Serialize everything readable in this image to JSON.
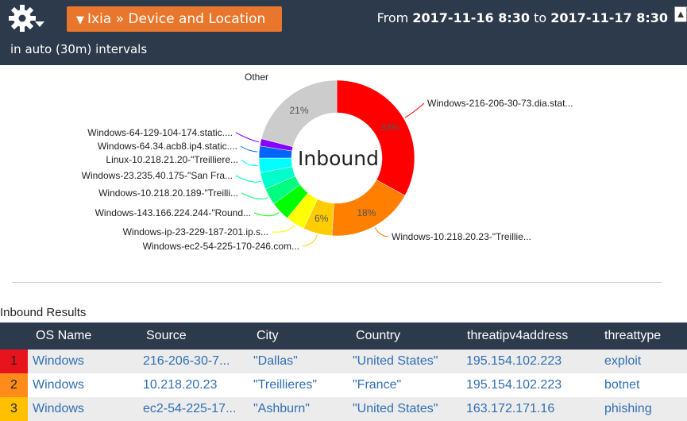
{
  "header": {
    "title": "Ixia » Device and Location",
    "range_from_label": "From",
    "range_from": "2017-11-16 8:30",
    "range_to_label": "to",
    "range_to": "2017-11-17 8:30",
    "interval": "in auto (30m) intervals"
  },
  "chart_data": {
    "type": "pie",
    "center_label": "Inbound",
    "slices": [
      {
        "label": "Windows-216-206-30-73.dia.stat...",
        "value": 33,
        "pct_label": "33%",
        "color": "#ff0000"
      },
      {
        "label": "Windows-10.218.20.23-\"Treillie...",
        "value": 18,
        "pct_label": "18%",
        "color": "#ff7f00"
      },
      {
        "label": "Windows-ec2-54-225-170-246.com...",
        "value": 6,
        "pct_label": "6%",
        "color": "#ffcc00"
      },
      {
        "label": "Windows-ip-23-229-187-201.ip.s...",
        "value": 4,
        "pct_label": "",
        "color": "#ffff00"
      },
      {
        "label": "Windows-143.166.224.244-\"Round...",
        "value": 4,
        "pct_label": "",
        "color": "#00ff00"
      },
      {
        "label": "Windows-10.218.20.189-\"Treilli...",
        "value": 3.5,
        "pct_label": "",
        "color": "#00ff7f"
      },
      {
        "label": "Windows-23.235.40.175-\"San Fra...",
        "value": 3.5,
        "pct_label": "",
        "color": "#00ffcc"
      },
      {
        "label": "Linux-10.218.21.20-\"Treilliere...",
        "value": 3,
        "pct_label": "",
        "color": "#00ffff"
      },
      {
        "label": "Windows-64.34.acb8.ip4.static....",
        "value": 2.5,
        "pct_label": "",
        "color": "#0066ff"
      },
      {
        "label": "Windows-64-129-104-174.static....",
        "value": 1.5,
        "pct_label": "",
        "color": "#8800ff"
      },
      {
        "label": "Other",
        "value": 21,
        "pct_label": "21%",
        "color": "#cccccc"
      }
    ]
  },
  "results": {
    "title": "Inbound Results",
    "columns": [
      "OS Name",
      "Source",
      "City",
      "Country",
      "threatipv4address",
      "threattype"
    ],
    "rows": [
      {
        "num": "1",
        "num_color": "#e8141d",
        "cells": [
          "Windows",
          "216-206-30-7...",
          "\"Dallas\"",
          "\"United States\"",
          "195.154.102.223",
          "exploit"
        ]
      },
      {
        "num": "2",
        "num_color": "#ff8c1a",
        "cells": [
          "Windows",
          "10.218.20.23",
          "\"Treillieres\"",
          "\"France\"",
          "195.154.102.223",
          "botnet"
        ]
      },
      {
        "num": "3",
        "num_color": "#ffc000",
        "cells": [
          "Windows",
          "ec2-54-225-17...",
          "\"Ashburn\"",
          "\"United States\"",
          "163.172.171.16",
          "phishing"
        ]
      }
    ]
  }
}
